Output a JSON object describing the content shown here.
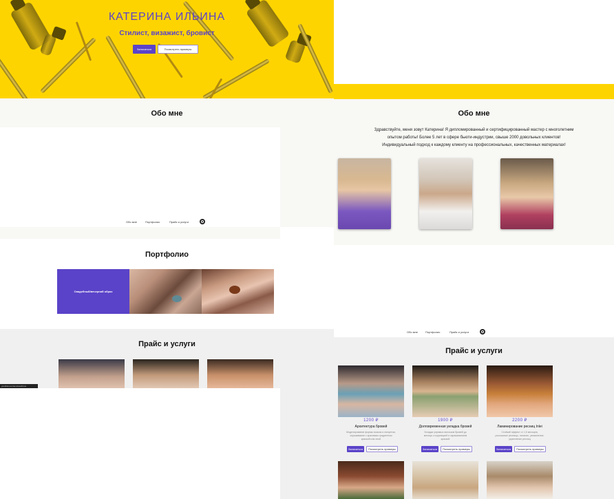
{
  "hero": {
    "title": "КАТЕРИНА ИЛЬИНА",
    "subtitle": "Стилист, визажист, бровист",
    "primary_button": "Записаться",
    "secondary_button": "Посмотреть примеры",
    "bg_color": "#fed400",
    "accent_color": "#5b43c9"
  },
  "left": {
    "about_title": "Обо мне",
    "nav": [
      "Обо мне",
      "Портфолио",
      "Прайс и услуги"
    ],
    "portfolio_title": "Портфолио",
    "portfolio_tile_label": "Свадебный/вечерний образ",
    "prices_title": "Прайс и услуги",
    "status_url": "yourlink.com/services/brow"
  },
  "right": {
    "about_title": "Обо мне",
    "about_text": [
      "Здравствуйте, меня зовут Катерина! Я дипломированный и сертифицированный мастер с многолетним",
      "опытом работы! Более 5 лет в сфере бьюти-индустрии, свыше 2000 довольных клиентов!",
      "Индивидуальный подход к каждому клиенту на профессиональных, качественных материалах!"
    ],
    "nav": [
      "Обо мне",
      "Портфолио",
      "Прайс и услуги"
    ],
    "prices_title": "Прайс и услуги",
    "services": [
      {
        "price": "1200 ₽",
        "name": "Архитектура бровей",
        "desc": [
          "Моделирование формы воском и пинцетом,",
          "окрашивание с красивым градиентом",
          "краской или хной"
        ],
        "btn_primary": "Записаться",
        "btn_secondary": "Посмотреть примеры"
      },
      {
        "price": "1900 ₽",
        "name": "Долговременная укладка бровей",
        "desc": [
          "Укладка упрямых волосков бровей до",
          "месяца с коррекцией и окрашиванием",
          "краской"
        ],
        "btn_primary": "Записаться",
        "btn_secondary": "Посмотреть примеры"
      },
      {
        "price": "2200 ₽",
        "name": "Ламинирование ресниц Inlei",
        "desc": [
          "Стойкий эффект от 1,5 месяцев,",
          "роскошные ресницы, питание, увлажнение,",
          "укрепление ресниц"
        ],
        "btn_primary": "Записаться",
        "btn_secondary": "Посмотреть примеры"
      }
    ]
  }
}
